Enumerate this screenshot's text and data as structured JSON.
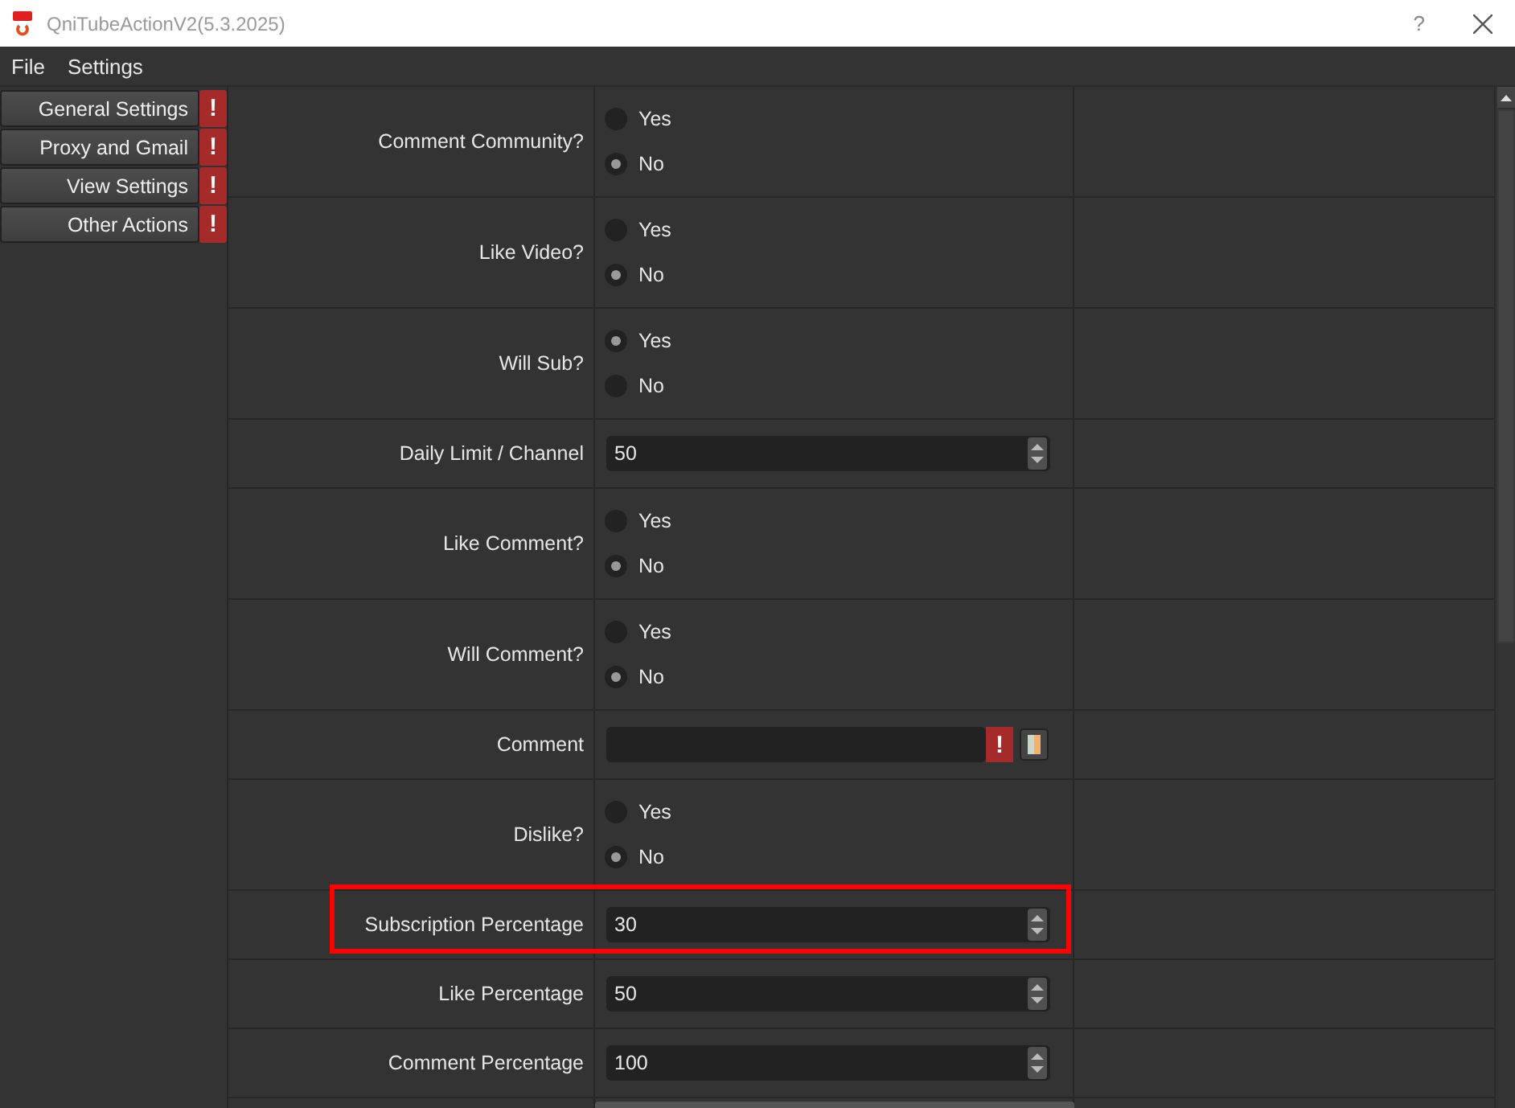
{
  "window": {
    "title": "QniTubeActionV2(5.3.2025)",
    "help": "?"
  },
  "menu": [
    "File",
    "Settings"
  ],
  "sidebar": {
    "items": [
      {
        "label": "General Settings",
        "alert": "!"
      },
      {
        "label": "Proxy and Gmail",
        "alert": "!"
      },
      {
        "label": "View Settings",
        "alert": "!"
      },
      {
        "label": "Other Actions",
        "alert": "!"
      }
    ]
  },
  "rows": [
    {
      "kind": "radio",
      "label": "Comment Community?",
      "options": [
        {
          "label": "Yes",
          "selected": false
        },
        {
          "label": "No",
          "selected": true
        }
      ]
    },
    {
      "kind": "radio",
      "label": "Like Video?",
      "options": [
        {
          "label": "Yes",
          "selected": false
        },
        {
          "label": "No",
          "selected": true
        }
      ]
    },
    {
      "kind": "radio",
      "label": "Will Sub?",
      "options": [
        {
          "label": "Yes",
          "selected": true
        },
        {
          "label": "No",
          "selected": false
        }
      ]
    },
    {
      "kind": "spin",
      "label": "Daily Limit / Channel",
      "value": "50"
    },
    {
      "kind": "radio",
      "label": "Like Comment?",
      "options": [
        {
          "label": "Yes",
          "selected": false
        },
        {
          "label": "No",
          "selected": true
        }
      ]
    },
    {
      "kind": "radio",
      "label": "Will Comment?",
      "options": [
        {
          "label": "Yes",
          "selected": false
        },
        {
          "label": "No",
          "selected": true
        }
      ]
    },
    {
      "kind": "text",
      "label": "Comment",
      "alert": "!"
    },
    {
      "kind": "radio",
      "label": "Dislike?",
      "options": [
        {
          "label": "Yes",
          "selected": false
        },
        {
          "label": "No",
          "selected": true
        }
      ]
    },
    {
      "kind": "spin",
      "label": "Subscription Percentage",
      "value": "30",
      "highlighted": true
    },
    {
      "kind": "spin",
      "label": "Like Percentage",
      "value": "50"
    },
    {
      "kind": "spin",
      "label": "Comment Percentage",
      "value": "100"
    }
  ]
}
